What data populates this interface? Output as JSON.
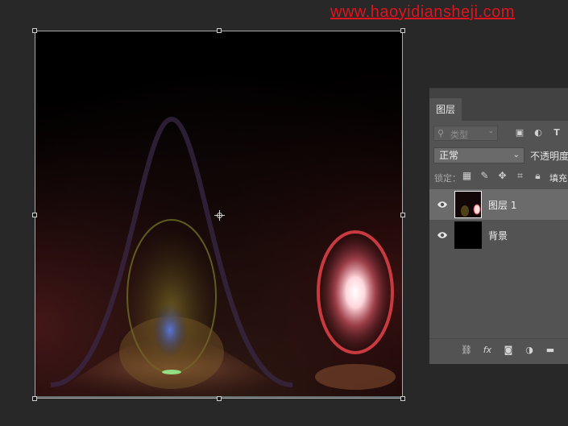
{
  "watermark": "www.haoyidiansheji.com",
  "canvas": {
    "image": "lens-flare-artwork"
  },
  "layers_panel": {
    "tab_label": "图层",
    "filter": {
      "placeholder": "类型",
      "icons": [
        "search-icon",
        "image-filter-icon",
        "adjustment-filter-icon",
        "type-filter-icon"
      ]
    },
    "blend_mode": "正常",
    "opacity_label": "不透明度",
    "lock_label": "锁定：",
    "lock_icons": [
      "lock-transparency-icon",
      "lock-image-icon",
      "lock-position-icon",
      "lock-artboard-icon",
      "lock-all-icon"
    ],
    "fill_label": "填充",
    "layers": [
      {
        "name": "图层 1",
        "visible": true,
        "selected": true
      },
      {
        "name": "背景",
        "visible": true,
        "selected": false
      }
    ],
    "bottom_icons": [
      "link-icon",
      "fx-icon",
      "mask-icon",
      "adjustment-icon",
      "folder-icon"
    ],
    "fx_label": "fx"
  },
  "colors": {
    "app_background": "#282828",
    "panel_background": "#535353",
    "selected_layer": "#6b6b6b",
    "watermark": "#e0141e"
  }
}
